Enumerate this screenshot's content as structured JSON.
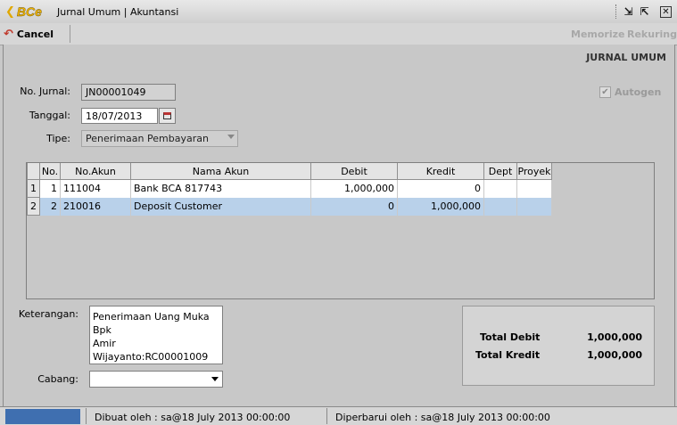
{
  "window": {
    "brand": "BCe",
    "title": "Jurnal Umum | Akuntansi"
  },
  "toolbar": {
    "cancel_label": "Cancel",
    "memorize_label": "Memorize",
    "rekuring_label": "Rekuring"
  },
  "header": {
    "heading": "JURNAL UMUM"
  },
  "form": {
    "no_jurnal_label": "No. Jurnal:",
    "no_jurnal_value": "JN00001049",
    "tanggal_label": "Tanggal:",
    "tanggal_value": "18/07/2013",
    "tipe_label": "Tipe:",
    "tipe_value": "Penerimaan Pembayaran",
    "autogen_label": "Autogen",
    "autogen_checked": true
  },
  "table": {
    "columns": [
      "No.",
      "No.Akun",
      "Nama Akun",
      "Debit",
      "Kredit",
      "Dept",
      "Proyek"
    ],
    "rows": [
      {
        "row": "1",
        "no": "1",
        "akun": "111004",
        "nama": "Bank BCA 817743",
        "debit": "1,000,000",
        "kredit": "0",
        "dept": "",
        "proyek": ""
      },
      {
        "row": "2",
        "no": "2",
        "akun": "210016",
        "nama": "Deposit Customer",
        "debit": "0",
        "kredit": "1,000,000",
        "dept": "",
        "proyek": ""
      }
    ],
    "selected_row": 2
  },
  "bottom": {
    "keterangan_label": "Keterangan:",
    "keterangan_line1": "Penerimaan Uang Muka Bpk",
    "keterangan_line2": "Amir Wijayanto:RC00001009",
    "cabang_label": "Cabang:",
    "cabang_value": ""
  },
  "totals": {
    "debit_label": "Total Debit",
    "debit_value": "1,000,000",
    "kredit_label": "Total Kredit",
    "kredit_value": "1,000,000"
  },
  "status": {
    "dibuat": "Dibuat oleh : sa@18 July 2013  00:00:00",
    "diperbarui": "Diperbarui oleh : sa@18 July 2013  00:00:00"
  },
  "colors": {
    "selected_row": "#b9d1ea",
    "brand": "#f2b600",
    "status_blue": "#3f6fb0"
  }
}
